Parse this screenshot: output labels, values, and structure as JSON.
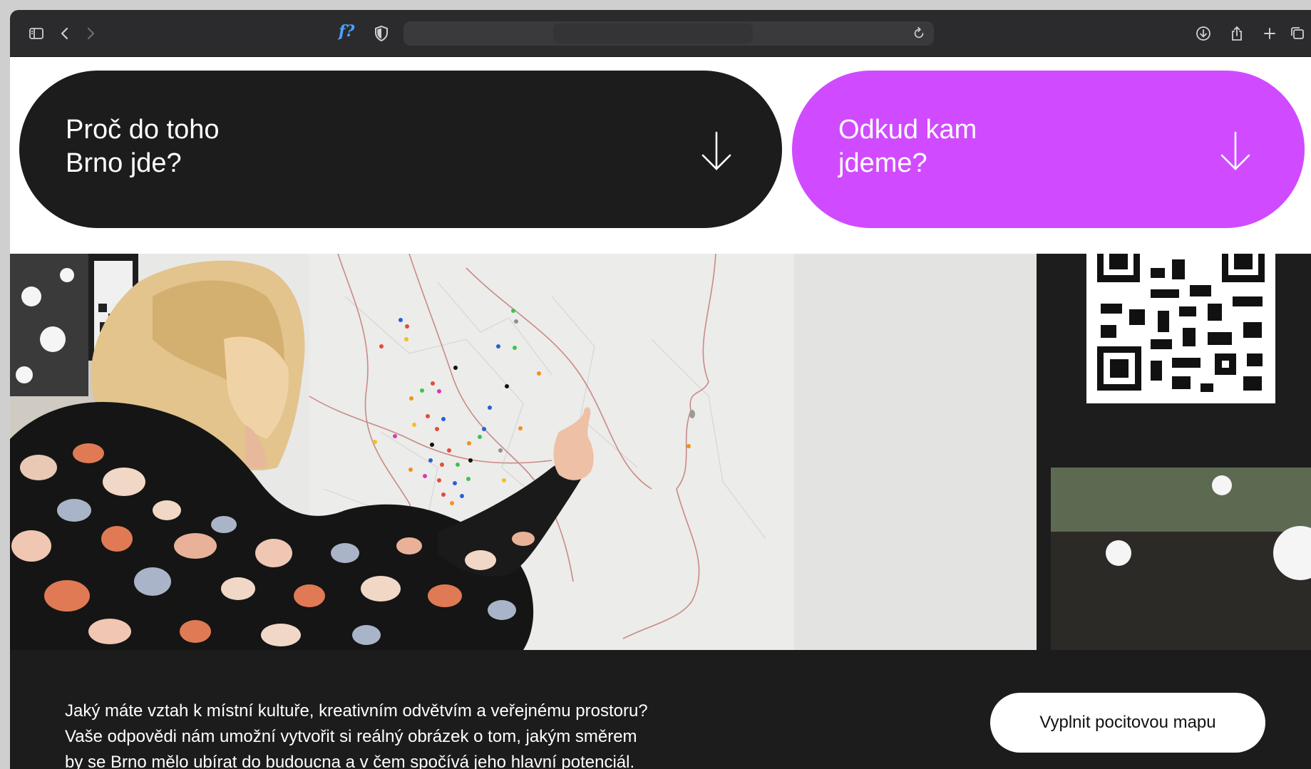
{
  "browser": {
    "extension_label": "f?",
    "url": ""
  },
  "hero": {
    "left_card": {
      "line1": "Proč do toho",
      "line2": "Brno jde?"
    },
    "right_card": {
      "line1": "Odkud kam",
      "line2": "jdeme?"
    }
  },
  "colors": {
    "dark_card": "#1c1c1c",
    "accent_purple": "#d04bff",
    "band_bg": "#1c1c1c"
  },
  "band": {
    "lines": [
      "Jaký máte vztah k místní kultuře, kreativním odvětvím a veřejnému prostoru?",
      "Vaše odpovědi nám umožní vytvořit si reálný obrázek o tom, jakým směrem",
      "by se Brno mělo ubírat do budoucna a v čem spočívá jeho hlavní potenciál."
    ],
    "cta_label": "Vyplnit pocitovou mapu"
  }
}
